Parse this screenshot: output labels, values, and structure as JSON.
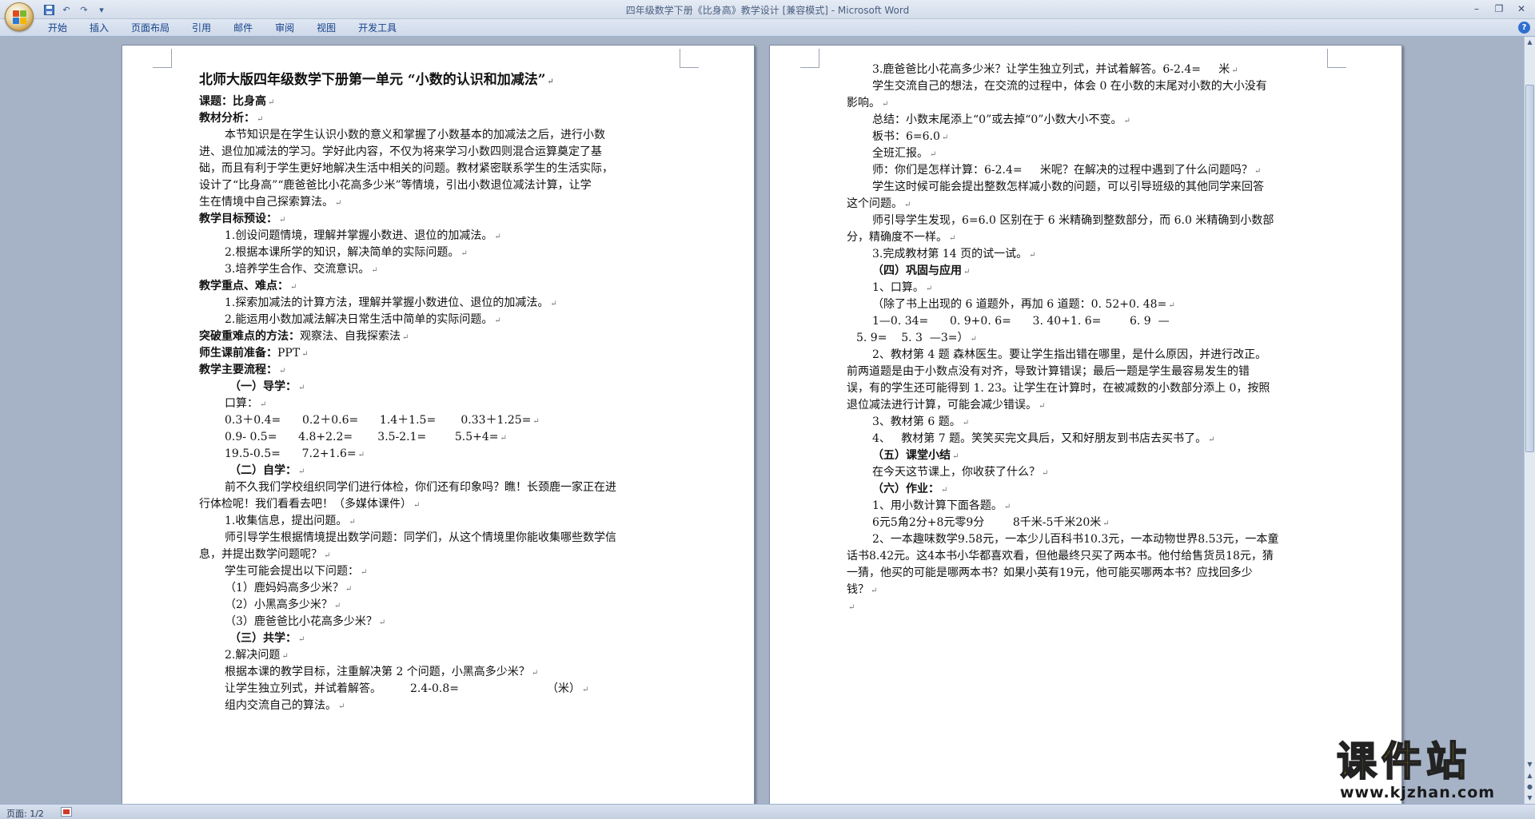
{
  "window": {
    "title": "四年级数学下册《比身高》教学设计 [兼容模式] - Microsoft Word",
    "controls": [
      "minimize-icon",
      "restore-icon",
      "close-icon"
    ]
  },
  "qat": {
    "items": [
      "save-icon",
      "undo-icon",
      "redo-icon",
      "customize-icon"
    ]
  },
  "ribbon_tabs": [
    "开始",
    "插入",
    "页面布局",
    "引用",
    "邮件",
    "审阅",
    "视图",
    "开发工具"
  ],
  "status": {
    "page": "页面: 1/2"
  },
  "watermark": {
    "title": "课件站",
    "url": "www.kjzhan.com"
  },
  "page_left": [
    "北师大版四年级数学下册第一单元 “小数的认识和加减法”",
    "课题：比身高",
    "教材分析：",
    "本节知识是在学生认识小数的意义和掌握了小数基本的加减法之后，进行小数",
    "进、退位加减法的学习。学好此内容，不仅为将来学习小数四则混合运算奠定了基",
    "础，而且有利于学生更好地解决生活中相关的问题。教材紧密联系学生的生活实际，",
    "设计了“比身高”“鹿爸爸比小花高多少米”等情境，引出小数退位减法计算，让学",
    "生在情境中自己探索算法。",
    "教学目标预设：",
    "1.创设问题情境，理解并掌握小数进、退位的加减法。",
    "2.根据本课所学的知识，解决简单的实际问题。",
    "3.培养学生合作、交流意识。",
    "教学重点、难点：",
    "1.探索加减法的计算方法，理解并掌握小数进位、退位的加减法。",
    "2.能运用小数加减法解决日常生活中简单的实际问题。",
    "突破重难点的方法：",
    "观察法、自我探索法",
    "师生课前准备：",
    "PPT",
    "教学主要流程：",
    "（一）导学：",
    "口算：",
    "0.3＋0.4=      0.2＋0.6=      1.4＋1.5=       0.33＋1.25=",
    "0.9- 0.5=      4.8+2.2=       3.5-2.1=        5.5+4=",
    "19.5-0.5=      7.2+1.6=",
    "（二）自学：",
    "前不久我们学校组织同学们进行体检，你们还有印象吗？瞧！长颈鹿一家正在进",
    "行体检呢！我们看看去吧！（多媒体课件）",
    "1.收集信息，提出问题。",
    "师引导学生根据情境提出数学问题：同学们，从这个情境里你能收集哪些数学信",
    "息，并提出数学问题呢？",
    "学生可能会提出以下问题：",
    "（1）鹿妈妈高多少米？",
    "（2）小黑高多少米？",
    "（3）鹿爸爸比小花高多少米？",
    "（三）共学：",
    "2.解决问题",
    "根据本课的教学目标，注重解决第 2 个问题，小黑高多少米？",
    "让学生独立列式，并试着解答。",
    "2.4-0.8=",
    "（米）",
    "组内交流自己的算法。"
  ],
  "page_right": [
    "3.鹿爸爸比小花高多少米？让学生独立列式，并试着解答。6-2.4=     米",
    "学生交流自己的想法，在交流的过程中，体会 0 在小数的末尾对小数的大小没有",
    "影响。",
    "总结：小数末尾添上“0”或去掉“0”小数大小不变。",
    "板书：6=6.0",
    "全班汇报。",
    "师：你们是怎样计算：6-2.4=     米呢？在解决的过程中遇到了什么问题吗？",
    "学生这时候可能会提出整数怎样减小数的问题，可以引导班级的其他同学来回答",
    "这个问题。",
    "师引导学生发现，6=6.0 区别在于 6 米精确到整数部分，而 6.0 米精确到小数部",
    "分，精确度不一样。",
    "3.完成教材第 14 页的试一试。",
    "（四）巩固与应用",
    "1、口算。",
    "（除了书上出现的 6 道题外，再加 6 道题：0. 52+0. 48=",
    "1—0. 34=      0. 9+0. 6=      3. 40+1. 6=        6. 9  —",
    "5. 9=    5. 3  —3=）",
    "2、教材第 4 题 森林医生。要让学生指出错在哪里，是什么原因，并进行改正。",
    "前两道题是由于小数点没有对齐，导致计算错误；最后一题是学生最容易发生的错",
    "误，有的学生还可能得到 1. 23。让学生在计算时，在被减数的小数部分添上 0，按照",
    "退位减法进行计算，可能会减少错误。",
    "3、教材第 6 题。",
    "4、   教材第 7 题。笑笑买完文具后，又和好朋友到书店去买书了。",
    "（五）课堂小结",
    "在今天这节课上，你收获了什么？",
    "（六）作业：",
    "1、用小数计算下面各题。",
    "6元5角2分+8元零9分        8千米-5千米20米",
    "2、一本趣味数学9.58元，一本少儿百科书10.3元，一本动物世界8.53元，一本童",
    "话书8.42元。这4本书小华都喜欢看，但他最终只买了两本书。他付给售货员18元，猜",
    "一猜，他买的可能是哪两本书？如果小英有19元，他可能买哪两本书？应找回多少",
    "钱？"
  ]
}
